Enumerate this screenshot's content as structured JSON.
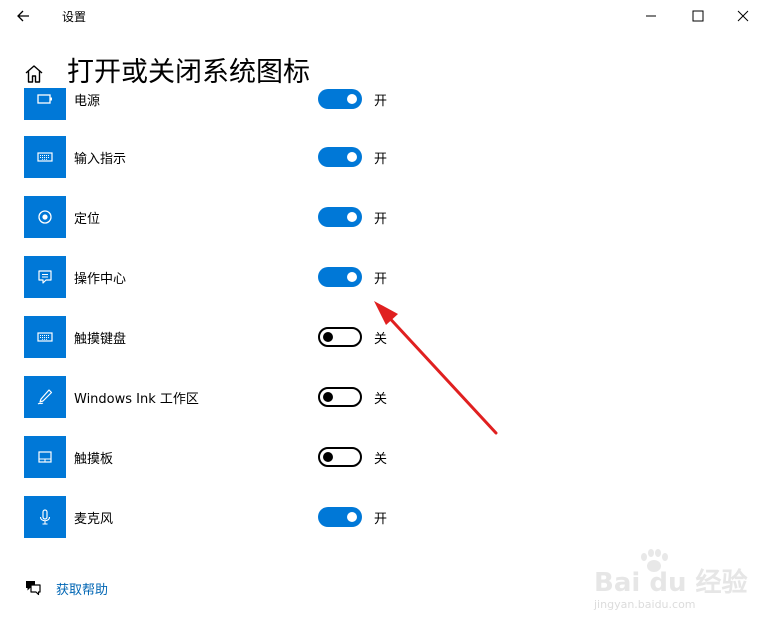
{
  "window": {
    "app_title": "设置"
  },
  "page": {
    "title": "打开或关闭系统图标"
  },
  "items": [
    {
      "label": "电源",
      "icon": "battery-icon",
      "on": true,
      "state": "开"
    },
    {
      "label": "输入指示",
      "icon": "keyboard-icon",
      "on": true,
      "state": "开"
    },
    {
      "label": "定位",
      "icon": "location-icon",
      "on": true,
      "state": "开"
    },
    {
      "label": "操作中心",
      "icon": "action-center-icon",
      "on": true,
      "state": "开"
    },
    {
      "label": "触摸键盘",
      "icon": "touch-keyboard-icon",
      "on": false,
      "state": "关"
    },
    {
      "label": "Windows Ink 工作区",
      "icon": "pen-icon",
      "on": false,
      "state": "关"
    },
    {
      "label": "触摸板",
      "icon": "touchpad-icon",
      "on": false,
      "state": "关"
    },
    {
      "label": "麦克风",
      "icon": "microphone-icon",
      "on": true,
      "state": "开"
    }
  ],
  "help": {
    "label": "获取帮助"
  },
  "watermark": {
    "main": "Bai du 经验",
    "sub": "jingyan.baidu.com"
  },
  "colors": {
    "accent": "#0078d7",
    "link": "#0066b4",
    "annotation_arrow": "#e02020"
  }
}
